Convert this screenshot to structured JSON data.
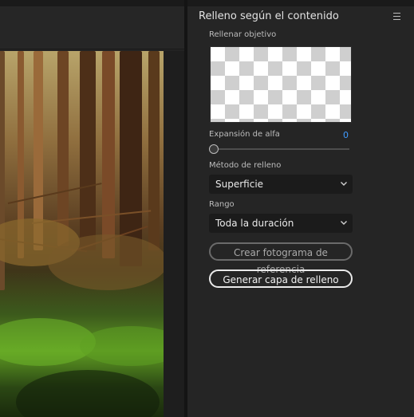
{
  "panel": {
    "title": "Relleno según el contenido",
    "fill_target_label": "Rellenar objetivo",
    "alpha_expansion_label": "Expansión de alfa",
    "alpha_expansion_value": "0",
    "alpha_slider_fraction": 0,
    "fill_method_label": "Método de relleno",
    "fill_method_value": "Superficie",
    "range_label": "Rango",
    "range_value": "Toda la duración",
    "create_reference_label": "Crear fotograma de referencia",
    "generate_fill_label": "Generar capa de relleno"
  },
  "icons": {
    "panel_menu": "hamburger-menu-icon",
    "dropdown": "chevron-down-icon"
  },
  "colors": {
    "accent_value": "#3f9bff",
    "panel_bg": "#252525",
    "app_bg": "#1d1d1d"
  }
}
